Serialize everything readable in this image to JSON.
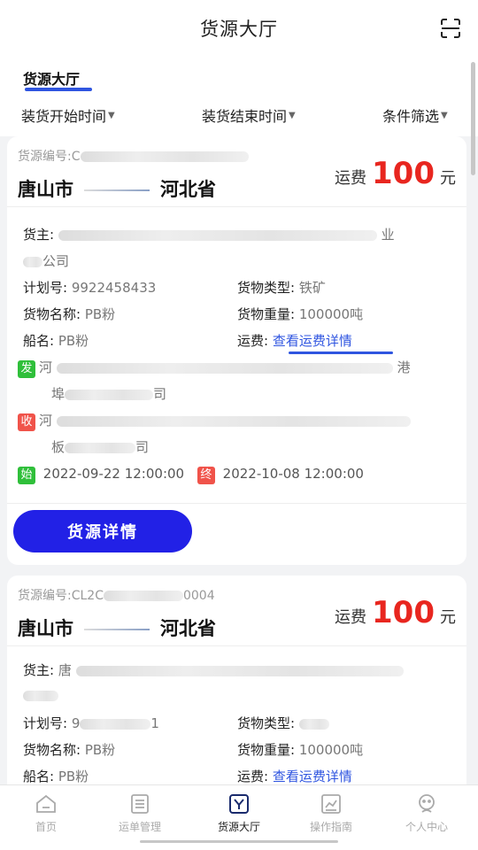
{
  "header": {
    "title": "货源大厅",
    "scan_icon": "scan-icon"
  },
  "tabs": [
    {
      "label": "货源大厅",
      "active": true
    }
  ],
  "filters": [
    {
      "label": "装货开始时间"
    },
    {
      "label": "装货结束时间"
    },
    {
      "label": "条件筛选"
    }
  ],
  "cards": [
    {
      "code_label": "货源编号:C",
      "from": "唐山市",
      "to": "河北省",
      "fee_label": "运费",
      "fee_value": "100",
      "fee_unit": "元",
      "shipper_label": "货主:",
      "shipper_tail": "业",
      "shipper_line2": "公司",
      "plan_label": "计划号:",
      "plan_value": "9922458433",
      "cargo_type_label": "货物类型:",
      "cargo_type_value": "铁矿",
      "cargo_name_label": "货物名称:",
      "cargo_name_value": "PB粉",
      "weight_label": "货物重量:",
      "weight_value": "100000吨",
      "ship_label": "船名:",
      "ship_value": "PB粉",
      "fee_detail_label": "运费:",
      "fee_detail_link": "查看运费详情",
      "send_tag": "发",
      "send_text": "河",
      "send_tail": "港",
      "send_line2": "埠",
      "send_line2_tail": "司",
      "recv_tag": "收",
      "recv_text": "河",
      "recv_line2": "板",
      "recv_line2_tail": "司",
      "start_tag": "始",
      "start_time": "2022-09-22 12:00:00",
      "end_tag": "终",
      "end_time": "2022-10-08 12:00:00",
      "detail_button": "货源详情"
    },
    {
      "code_label": "货源编号:CL2C",
      "code_tail": "0004",
      "from": "唐山市",
      "to": "河北省",
      "fee_label": "运费",
      "fee_value": "100",
      "fee_unit": "元",
      "shipper_label": "货主:",
      "shipper_text": "唐",
      "plan_label": "计划号:",
      "plan_value": "9",
      "plan_tail": "1",
      "cargo_type_label": "货物类型:",
      "cargo_name_label": "货物名称:",
      "cargo_name_value": "PB粉",
      "weight_label": "货物重量:",
      "weight_value": "100000吨",
      "ship_label": "船名:",
      "ship_value": "PB粉",
      "fee_detail_label": "运费:",
      "fee_detail_link": "查看运费详情"
    }
  ],
  "nav": [
    {
      "label": "首页",
      "icon": "home-icon",
      "active": false
    },
    {
      "label": "运单管理",
      "icon": "waybill-icon",
      "active": false
    },
    {
      "label": "货源大厅",
      "icon": "cargo-hall-icon",
      "active": true
    },
    {
      "label": "操作指南",
      "icon": "guide-icon",
      "active": false
    },
    {
      "label": "个人中心",
      "icon": "profile-icon",
      "active": false
    }
  ],
  "colors": {
    "accent": "#2f55e0",
    "fee_red": "#e8261f",
    "button": "#2221e6",
    "green_tag": "#2fbf3a",
    "red_tag": "#f0534a"
  }
}
